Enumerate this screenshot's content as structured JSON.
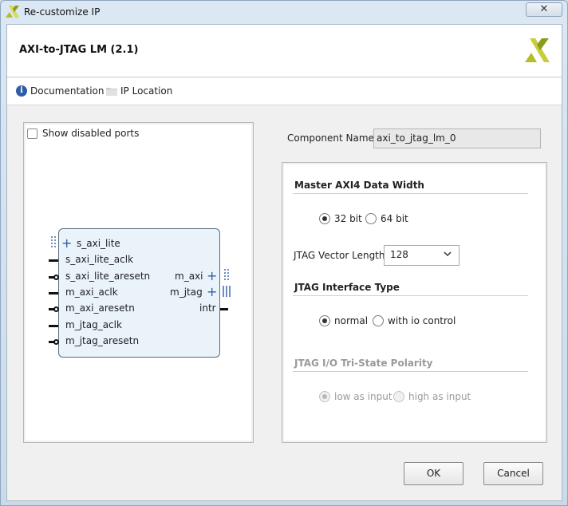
{
  "window": {
    "title": "Re-customize IP",
    "close_glyph": "✕"
  },
  "header": {
    "title": "AXI-to-JTAG LM (2.1)"
  },
  "links": {
    "documentation": "Documentation",
    "ip_location": "IP Location",
    "documentation_icon": "info-icon",
    "ip_location_icon": "folder-icon"
  },
  "symbol_panel": {
    "show_disabled_label": "Show disabled ports",
    "show_disabled_checked": false,
    "left_ports": [
      {
        "label": "s_axi_lite",
        "kind": "bus"
      },
      {
        "label": "s_axi_lite_aclk",
        "kind": "clock"
      },
      {
        "label": "s_axi_lite_aresetn",
        "kind": "reset"
      },
      {
        "label": "m_axi_aclk",
        "kind": "clock"
      },
      {
        "label": "m_axi_aresetn",
        "kind": "reset"
      },
      {
        "label": "m_jtag_aclk",
        "kind": "clock"
      },
      {
        "label": "m_jtag_aresetn",
        "kind": "reset"
      }
    ],
    "right_ports": [
      {
        "label": "m_axi",
        "kind": "bus"
      },
      {
        "label": "m_jtag",
        "kind": "bus"
      },
      {
        "label": "intr",
        "kind": "signal"
      }
    ]
  },
  "config": {
    "component_name_label": "Component Name",
    "component_name_value": "axi_to_jtag_lm_0",
    "data_width": {
      "title": "Master AXI4 Data Width",
      "options": [
        "32 bit",
        "64 bit"
      ],
      "selected": "32 bit"
    },
    "vector_length": {
      "label": "JTAG Vector Length",
      "value": "128"
    },
    "interface_type": {
      "title": "JTAG Interface Type",
      "options": [
        "normal",
        "with io control"
      ],
      "selected": "normal"
    },
    "tristate_polarity": {
      "title": "JTAG I/O Tri-State Polarity",
      "options": [
        "low as input",
        "high as input"
      ],
      "selected": "low as input",
      "enabled": false
    }
  },
  "buttons": {
    "ok": "OK",
    "cancel": "Cancel"
  },
  "colors": {
    "xilinx_logo": "#b5bd2a",
    "info_icon": "#2d5da8",
    "block_fill": "#eaf2fa"
  }
}
